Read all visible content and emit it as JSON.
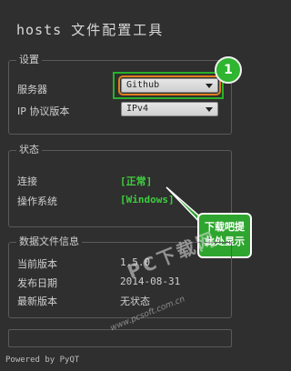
{
  "app": {
    "title_prefix": "hosts",
    "title_zh": "文件配置工具",
    "footer": "Powered by PyQT"
  },
  "settings": {
    "group_title": "设置",
    "server_label": "服务器",
    "server_value": "Github",
    "ip_label": "IP 协议版本",
    "ip_value": "IPv4"
  },
  "status": {
    "group_title": "状态",
    "connection_label": "连接",
    "connection_value": "[正常]",
    "os_label": "操作系统",
    "os_value": "[Windows]"
  },
  "data_info": {
    "group_title": "数据文件信息",
    "current_version_label": "当前版本",
    "current_version_value": "1.5.0",
    "release_date_label": "发布日期",
    "release_date_value": "2014-08-31",
    "latest_version_label": "最新版本",
    "latest_version_value": "无状态"
  },
  "annotations": {
    "badge_number": "1",
    "callout_line1": "下载吧提",
    "callout_line2": "此处显示"
  },
  "watermark": {
    "text": "PC下载网",
    "url": "www.pcsoft.com.cn"
  },
  "colors": {
    "accent_green": "#2fb52f",
    "status_green": "#3ecc3e",
    "highlight_orange": "#e07f1f",
    "background": "#2f2f2f"
  }
}
